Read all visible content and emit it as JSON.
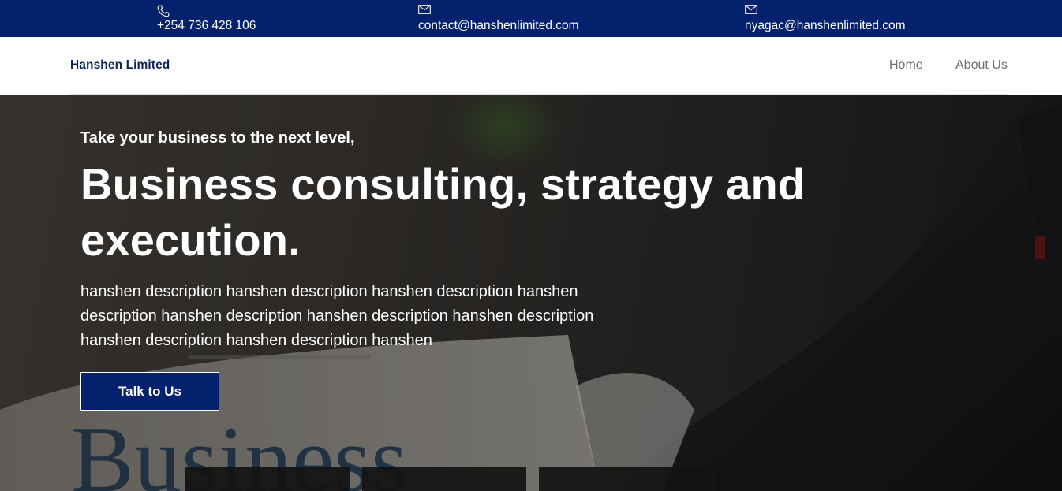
{
  "topbar": {
    "phone": {
      "icon": "phone-icon",
      "text": "+254 736 428 106"
    },
    "email_primary": {
      "icon": "envelope-icon",
      "text": "contact@hanshenlimited.com"
    },
    "email_secondary": {
      "icon": "envelope-icon",
      "text": "nyagac@hanshenlimited.com"
    }
  },
  "navbar": {
    "brand": "Hanshen Limited",
    "links": [
      {
        "label": "Home"
      },
      {
        "label": "About Us"
      }
    ]
  },
  "hero": {
    "kicker": "Take your business to the next level,",
    "headline": "Business consulting, strategy and execution.",
    "description": "hanshen description hanshen description hanshen description hanshen description hanshen description hanshen description hanshen description hanshen description hanshen description hanshen",
    "cta_label": "Talk to Us",
    "background_image_text": "Business"
  },
  "colors": {
    "brand_navy": "#04216d",
    "white": "#ffffff",
    "nav_link": "#6b7077",
    "card_dark": "#121212"
  }
}
